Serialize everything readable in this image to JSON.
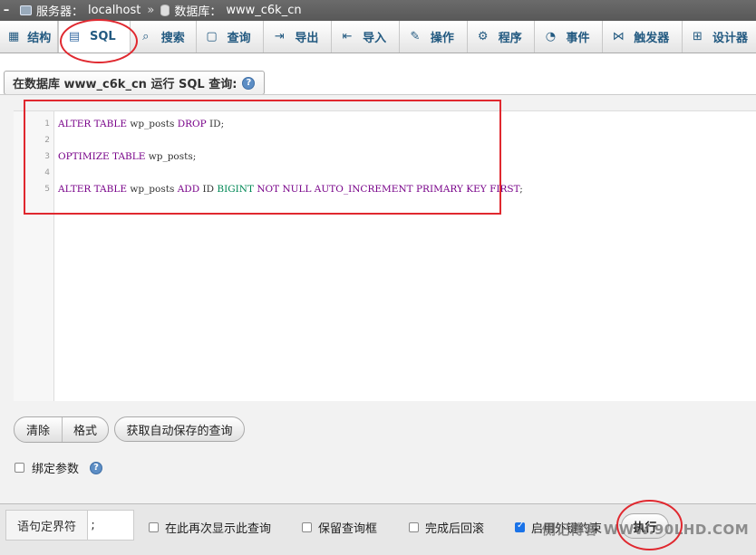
{
  "breadcrumb": {
    "server_label": "服务器：",
    "server_value": "localhost",
    "separator": "»",
    "db_label": "数据库：",
    "db_value": "www_c6k_cn"
  },
  "tabs": [
    {
      "label": "结构",
      "icon": "structure-icon"
    },
    {
      "label": "SQL",
      "icon": "sql-icon",
      "active": true
    },
    {
      "label": "搜索",
      "icon": "search-icon"
    },
    {
      "label": "查询",
      "icon": "query-icon"
    },
    {
      "label": "导出",
      "icon": "export-icon"
    },
    {
      "label": "导入",
      "icon": "import-icon"
    },
    {
      "label": "操作",
      "icon": "wrench-icon"
    },
    {
      "label": "程序",
      "icon": "routines-icon"
    },
    {
      "label": "事件",
      "icon": "clock-icon"
    },
    {
      "label": "触发器",
      "icon": "trigger-icon"
    },
    {
      "label": "设计器",
      "icon": "designer-icon"
    }
  ],
  "query_title": "在数据库 www_c6k_cn 运行 SQL 查询:",
  "editor": {
    "line_numbers": [
      "1",
      "2",
      "3",
      "4",
      "5"
    ],
    "lines": [
      "ALTER TABLE wp_posts DROP ID;",
      "",
      "OPTIMIZE TABLE wp_posts;",
      "",
      "ALTER TABLE wp_posts ADD ID BIGINT NOT NULL AUTO_INCREMENT PRIMARY KEY FIRST;"
    ]
  },
  "buttons": {
    "clear": "清除",
    "format": "格式",
    "get_autosaved": "获取自动保存的查询"
  },
  "bind_params": {
    "label": "绑定参数",
    "checked": false
  },
  "bottom": {
    "delimiter_label": "语句定界符",
    "delimiter_value": ";",
    "show_again": {
      "label": "在此再次显示此查询",
      "checked": false
    },
    "retain_box": {
      "label": "保留查询框",
      "checked": false
    },
    "rollback": {
      "label": "完成后回滚",
      "checked": false
    },
    "foreign_keys": {
      "label": "启用外键约束",
      "checked": true
    },
    "go": "执行"
  },
  "watermark": "侧记博客 WWW.90LHD.COM",
  "colors": {
    "annotation": "#e0282f",
    "keyword": "#770088",
    "type": "#008855",
    "tab_text": "#235a81"
  }
}
